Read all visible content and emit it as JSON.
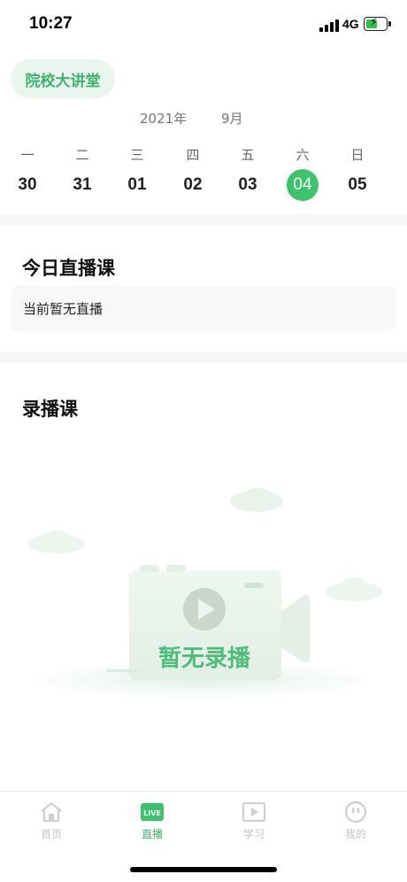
{
  "status_bar": {
    "time": "10:27",
    "network": "4G"
  },
  "header": {
    "title": "院校大讲堂"
  },
  "calendar": {
    "year_label": "2021年",
    "month_label": "9月",
    "weekdays": [
      "一",
      "二",
      "三",
      "四",
      "五",
      "六",
      "日"
    ],
    "dates": [
      "30",
      "31",
      "01",
      "02",
      "03",
      "04",
      "05"
    ],
    "selected_date": "04"
  },
  "live_section": {
    "title": "今日直播课",
    "empty_text": "当前暂无直播"
  },
  "recorded_section": {
    "title": "录播课",
    "empty_text": "暂无录播"
  },
  "tabbar": {
    "items": [
      {
        "label": "首页",
        "icon": "home-icon",
        "active": false
      },
      {
        "label": "直播",
        "icon": "live-icon",
        "active": true
      },
      {
        "label": "学习",
        "icon": "play-icon",
        "active": false
      },
      {
        "label": "我的",
        "icon": "profile-icon",
        "active": false
      }
    ]
  },
  "colors": {
    "accent": "#3dc36c",
    "accent_text": "#3cb46b",
    "pill_bg": "#e9f6ee",
    "inactive": "#c4c4c4"
  }
}
